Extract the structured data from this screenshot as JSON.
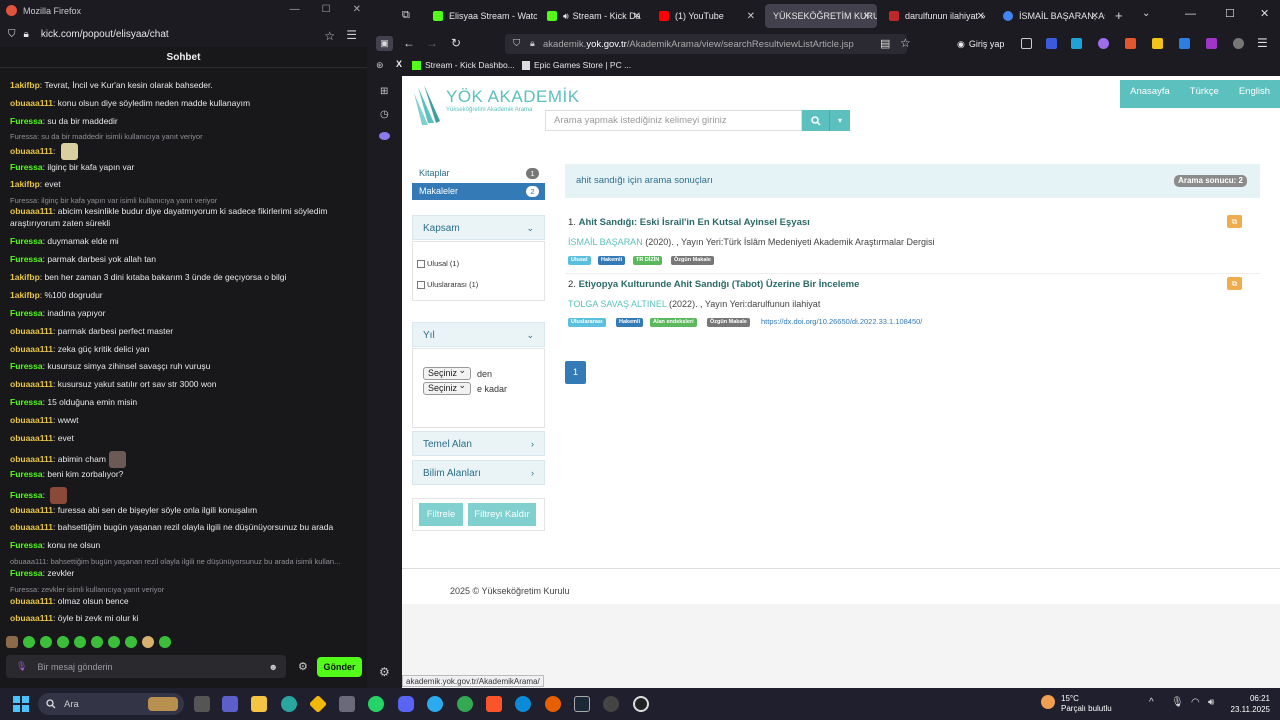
{
  "left_window": {
    "title": "Mozilla Firefox",
    "url": "kick.com/popout/elisyaa/chat",
    "chat_title": "Sohbet",
    "messages": [
      {
        "user": "1akifbp",
        "text": "Tevrat, İncil ve Kur'an kesin olarak bahseder.",
        "color": "#e8c547"
      },
      {
        "user": "obuaaa111",
        "text": "konu olsun diye söyledim neden madde kullanayım",
        "color": "#e8c547"
      },
      {
        "user": "Furessa",
        "text": "su da bir maddedir",
        "color": "#53fc18"
      },
      {
        "reply": "Furessa: su da bir maddedir isimli kullanıcıya yanıt veriyor"
      },
      {
        "user": "obuaaa111",
        "text": "",
        "emote": true,
        "color": "#e8c547"
      },
      {
        "user": "Furessa",
        "text": "ilginç bir kafa yapın var",
        "color": "#53fc18"
      },
      {
        "user": "1akifbp",
        "text": "evet",
        "color": "#e8c547"
      },
      {
        "reply": "Furessa: ilginç bir kafa yapın var isimli kullanıcıya yanıt veriyor"
      },
      {
        "user": "obuaaa111",
        "text": "abicim kesinlikle budur diye dayatmıyorum ki sadece fikirlerimi söyledim",
        "color": "#e8c547"
      },
      {
        "cont": "araştırıyorum zaten sürekli"
      },
      {
        "user": "Furessa",
        "text": "duymamak elde mi",
        "color": "#53fc18"
      },
      {
        "user": "Furessa",
        "text": "parmak darbesi yok allah tan",
        "color": "#53fc18"
      },
      {
        "user": "1akifbp",
        "text": "ben her zaman 3 dini kıtaba bakarım 3 ünde de geçıyorsa o bilgi",
        "color": "#e8c547"
      },
      {
        "user": "1akifbp",
        "text": "%100 dogrudur",
        "color": "#e8c547"
      },
      {
        "user": "Furessa",
        "text": "inadına yapıyor",
        "color": "#53fc18"
      },
      {
        "user": "obuaaa111",
        "text": "parmak darbesi perfect master",
        "color": "#e8c547"
      },
      {
        "user": "obuaaa111",
        "text": "zeka güç kritik delici yan",
        "color": "#e8c547"
      },
      {
        "user": "Furessa",
        "text": "kusursuz simya zihinsel savaşçı ruh vuruşu",
        "color": "#53fc18"
      },
      {
        "user": "obuaaa111",
        "text": "kusursuz yakut satılır ort sav str 3000 won",
        "color": "#e8c547"
      },
      {
        "user": "Furessa",
        "text": "15 olduğuna emin misin",
        "color": "#53fc18"
      },
      {
        "user": "obuaaa111",
        "text": "wwwt",
        "color": "#e8c547"
      },
      {
        "user": "obuaaa111",
        "text": "evet",
        "color": "#e8c547"
      },
      {
        "user": "obuaaa111",
        "text": "abimin cham",
        "emote": true,
        "color": "#e8c547"
      },
      {
        "user": "Furessa",
        "text": "beni kim zorbalıyor?",
        "color": "#53fc18"
      },
      {
        "user": "Furessa",
        "text": "",
        "emote": true,
        "color": "#53fc18"
      },
      {
        "user": "obuaaa111",
        "text": "furessa abi sen de bişeyler söyle onla ilgili konuşalım",
        "color": "#e8c547"
      },
      {
        "user": "obuaaa111",
        "text": "bahsettiğim bugün yaşanan rezil olayla ilgili ne düşünüyorsunuz bu arada",
        "color": "#e8c547"
      },
      {
        "user": "Furessa",
        "text": "konu ne olsun",
        "color": "#53fc18"
      },
      {
        "reply": "obuaaa111: bahsettiğim bugün yaşanan rezil olayla ilgili ne düşünüyorsunuz bu arada isimli kullan..."
      },
      {
        "user": "Furessa",
        "text": "zevkler",
        "color": "#53fc18"
      },
      {
        "reply": "Furessa: zevkler isimli kullanıcıya yanıt veriyor"
      },
      {
        "user": "obuaaa111",
        "text": "olmaz olsun bence",
        "color": "#e8c547"
      },
      {
        "user": "obuaaa111",
        "text": "öyle bi zevk mi olur ki",
        "color": "#e8c547"
      }
    ],
    "input_placeholder": "Bir mesaj gönderin",
    "send_label": "Gönder"
  },
  "right_window": {
    "tabs": [
      {
        "label": "Elisyaa Stream - Watc",
        "color": "#53fc18"
      },
      {
        "label": "Stream - Kick Da",
        "color": "#53fc18"
      },
      {
        "label": "(1) YouTube",
        "color": "#ff0000"
      },
      {
        "label": "YÜKSEKÖĞRETİM KURUL",
        "color": "#5bc0be"
      },
      {
        "label": "darulfunun ilahiyat »",
        "color": "#c0272d"
      },
      {
        "label": "İSMAİL BAŞARAN, As",
        "color": "#4285f4"
      }
    ],
    "url_prefix": "akademik.",
    "url_domain": "yok.gov.tr",
    "url_path": "/AkademikArama/view/searchResultviewListArticle.jsp",
    "signin_label": "Giriş yap",
    "bookmarks": [
      "Stream - Kick Dashbo...",
      "Epic Games Store | PC ..."
    ]
  },
  "page": {
    "topnav": [
      "Anasayfa",
      "Türkçe",
      "English"
    ],
    "logo_text": "YÖK AKADEMİK",
    "logo_sub": "Yükseköğretim Akademik Arama",
    "search_placeholder": "Arama yapmak istediğiniz kelimeyi giriniz",
    "nav": [
      {
        "label": "Kitaplar",
        "count": "1"
      },
      {
        "label": "Makaleler",
        "count": "2"
      }
    ],
    "kapsam_title": "Kapsam",
    "kapsam_options": [
      "Ulusal (1)",
      "Uluslararası (1)"
    ],
    "yil_title": "Yıl",
    "select_value": "Seçiniz",
    "from_label": "den",
    "to_label": "e kadar",
    "temel_alan": "Temel Alan",
    "bilim_alanlari": "Bilim Alanları",
    "filter_btn": "Filtrele",
    "clear_btn": "Filtreyi Kaldır",
    "results_header": "ahit sandığı için arama sonuçları",
    "results_count": "Arama sonucu: 2",
    "results": [
      {
        "num": "1.",
        "title": "Ahit Sandığı: Eski İsrail'in En Kutsal Ayinsel Eşyası",
        "author": "İSMAİL BAŞARAN",
        "meta": " (2020). , Yayın Yeri:Türk İslâm Medeniyeti Akademik Araştırmalar Dergisi",
        "labels": [
          {
            "text": "Ulusal",
            "color": "#5bc0de"
          },
          {
            "text": "Hakemli",
            "color": "#337ab7"
          },
          {
            "text": "TR DİZİN",
            "color": "#5cb85c"
          },
          {
            "text": "Özgün Makale",
            "color": "#777777"
          }
        ],
        "doi": ""
      },
      {
        "num": "2.",
        "title": "Etiyopya Kulturunde Ahit Sandığı (Tabot) Üzerine Bir İnceleme",
        "author": "TOLGA SAVAŞ ALTINEL",
        "meta": " (2022). , Yayın Yeri:darulfunun ilahiyat",
        "labels": [
          {
            "text": "Uluslararası",
            "color": "#5bc0de"
          },
          {
            "text": "Hakemli",
            "color": "#337ab7"
          },
          {
            "text": "Alan endeksleri",
            "color": "#5cb85c"
          },
          {
            "text": "Özgün Makale",
            "color": "#777777"
          }
        ],
        "doi": "https://dx.doi.org/10.26650/di.2022.33.1.108450/"
      }
    ],
    "page_number": "1",
    "footer": "2025 © Yükseköğretim Kurulu",
    "status_url": "akademik.yok.gov.tr/AkademikArama/"
  },
  "taskbar": {
    "search_label": "Ara",
    "weather_temp": "15°C",
    "weather_desc": "Parçalı bulutlu",
    "time": "06:21",
    "date": "23.11.2025"
  }
}
